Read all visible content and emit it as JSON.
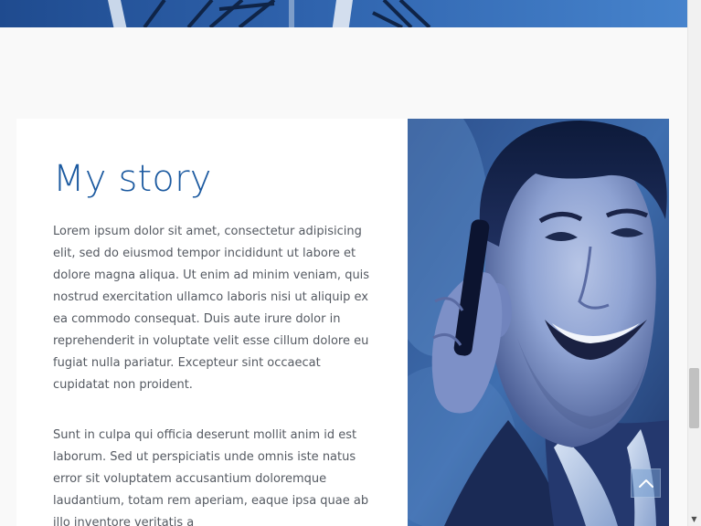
{
  "story": {
    "title": "My story",
    "paragraphs": [
      "Lorem ipsum dolor sit amet, consectetur adipisicing elit, sed do eiusmod tempor incididunt ut labore et dolore magna aliqua. Ut enim ad minim veniam, quis nostrud exercitation ullamco laboris nisi ut aliquip ex ea commodo consequat. Duis aute irure dolor in reprehenderit in voluptate velit esse cillum dolore eu fugiat nulla pariatur. Excepteur sint occaecat cupidatat non proident.",
      "Sunt in culpa qui officia deserunt mollit anim id est laborum. Sed ut perspiciatis unde omnis iste natus error sit voluptatem accusantium doloremque laudantium, totam rem aperiam, eaque ipsa quae ab illo inventore veritatis a"
    ]
  },
  "photo": {
    "icon": "smiling-man-on-phone-photo"
  },
  "scroll_top": {
    "icon": "chevron-up-icon"
  },
  "scrollbar": {
    "down_arrow": "▼"
  },
  "colors": {
    "title": "#1c5aa0",
    "body_text": "#555a62",
    "card_bg": "#ffffff",
    "section_bg": "#f9f9f9",
    "hero": "#2c5fa8"
  }
}
